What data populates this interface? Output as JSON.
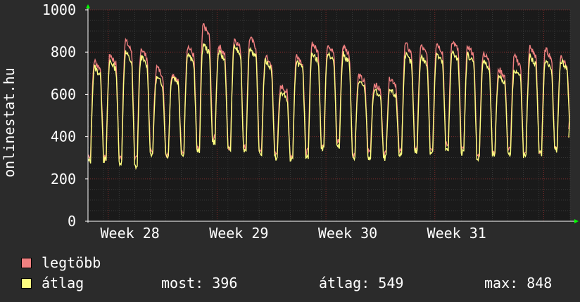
{
  "chart_data": {
    "type": "line",
    "ylabel": "onlinestat.hu",
    "ylim": [
      0,
      1000
    ],
    "yticks": [
      0,
      200,
      400,
      600,
      800,
      1000
    ],
    "x_labels": [
      "Week 28",
      "Week 29",
      "Week 30",
      "Week 31"
    ],
    "x_days": 31,
    "grid": true,
    "series": [
      {
        "name": "legtöbb",
        "color": "#f08080",
        "daily_peaks": [
          760,
          790,
          855,
          820,
          730,
          700,
          830,
          930,
          830,
          865,
          870,
          780,
          640,
          790,
          845,
          840,
          830,
          690,
          650,
          680,
          840,
          830,
          845,
          855,
          830,
          800,
          720,
          780,
          825,
          815,
          780
        ],
        "daily_lows": [
          310,
          300,
          300,
          295,
          330,
          320,
          330,
          340,
          390,
          350,
          350,
          340,
          330,
          310,
          330,
          360,
          380,
          320,
          330,
          320,
          330,
          350,
          345,
          360,
          340,
          310,
          330,
          340,
          320,
          330,
          350
        ],
        "end_value": 435
      },
      {
        "name": "átlag",
        "color": "#ffff80",
        "daily_peaks": [
          730,
          760,
          800,
          780,
          680,
          690,
          790,
          840,
          800,
          830,
          820,
          760,
          610,
          760,
          800,
          800,
          790,
          660,
          620,
          620,
          790,
          780,
          790,
          800,
          790,
          760,
          690,
          720,
          780,
          760,
          760
        ],
        "daily_lows": [
          285,
          290,
          280,
          260,
          320,
          310,
          320,
          330,
          375,
          340,
          340,
          320,
          300,
          290,
          310,
          345,
          360,
          305,
          300,
          300,
          315,
          330,
          330,
          335,
          325,
          300,
          315,
          320,
          310,
          320,
          340
        ],
        "end_value": 396
      }
    ],
    "stats": {
      "most": "most: 396",
      "atlag": "átlag: 549",
      "max": "max: 848"
    }
  },
  "legend": {
    "max_label": "legtöbb",
    "avg_label": "átlag"
  },
  "colors": {
    "background": "#2b2b2b",
    "plot": "#1a1a1a",
    "grid_minor": "#4a4a4a",
    "grid_major": "#7a2a2a",
    "axis": "#ffffff",
    "arrow": "#00ff00"
  }
}
